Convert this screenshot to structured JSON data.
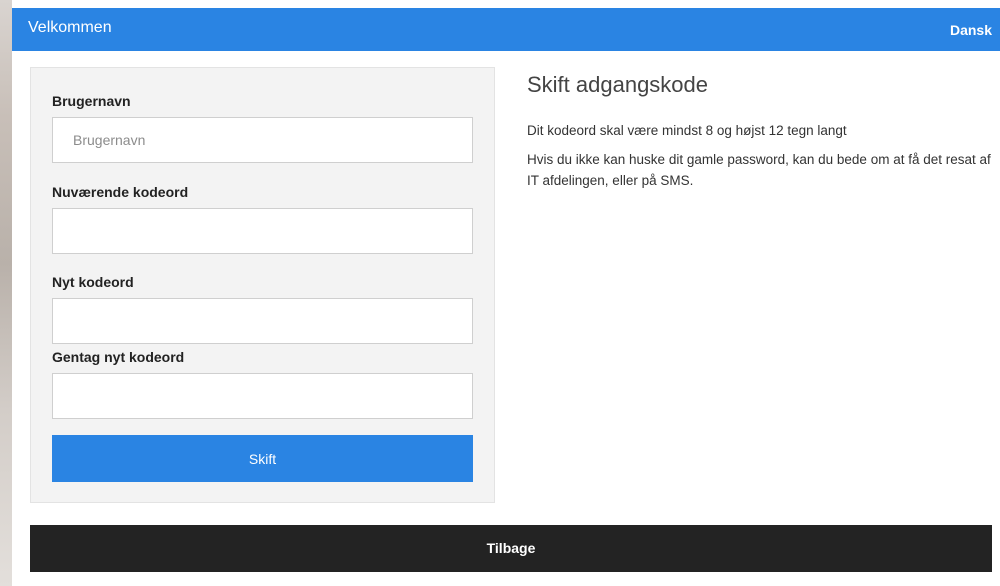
{
  "header": {
    "title": "Velkommen",
    "language": "Dansk"
  },
  "form": {
    "username_label": "Brugernavn",
    "username_placeholder": "Brugernavn",
    "username_value": "",
    "current_password_label": "Nuværende kodeord",
    "current_password_value": "",
    "new_password_label": "Nyt kodeord",
    "new_password_value": "",
    "repeat_password_label": "Gentag nyt kodeord",
    "repeat_password_value": "",
    "submit_label": "Skift"
  },
  "info": {
    "heading": "Skift adgangskode",
    "paragraphs": [
      "Dit kodeord skal være mindst 8 og højst 12 tegn langt",
      "Hvis du ikke kan huske dit gamle password, kan du bede om at få det resat af IT afdelingen, eller på SMS."
    ]
  },
  "footer": {
    "back_label": "Tilbage"
  },
  "colors": {
    "primary": "#2a84e3",
    "footer_bg": "#232323",
    "panel_bg": "#f3f3f3"
  }
}
